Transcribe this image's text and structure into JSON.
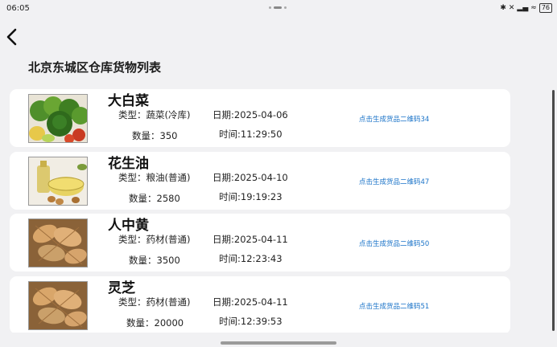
{
  "status_bar": {
    "time": "06:05",
    "battery": "76",
    "icons": [
      "bluetooth-icon",
      "mute-icon",
      "signal-icon",
      "wifi-icon"
    ]
  },
  "header": {
    "back_icon": "chevron-left-icon",
    "title": "北京东城区仓库货物列表"
  },
  "items": [
    {
      "name": "大白菜",
      "type": "类型：蔬菜(冷库)",
      "date": "日期:2025-04-06",
      "quantity": "数量：350",
      "time": "时间:11:29:50",
      "link": "点击生成货品二维码34",
      "image": "vegetables-photo"
    },
    {
      "name": "花生油",
      "type": "类型：粮油(普通)",
      "date": "日期:2025-04-10",
      "quantity": "数量：2580",
      "time": "时间:19:19:23",
      "link": "点击生成货品二维码47",
      "image": "oil-photo"
    },
    {
      "name": "人中黄",
      "type": "类型：药材(普通)",
      "date": "日期:2025-04-11",
      "quantity": "数量：3500",
      "time": "时间:12:23:43",
      "link": "点击生成货品二维码50",
      "image": "herb-slices-photo"
    },
    {
      "name": "灵芝",
      "type": "类型：药材(普通)",
      "date": "日期:2025-04-11",
      "quantity": "数量：20000",
      "time": "时间:12:39:53",
      "link": "点击生成货品二维码51",
      "image": "herb-slices-photo"
    }
  ],
  "colors": {
    "background": "#f1f1f3",
    "card": "#ffffff",
    "link": "#1a73c8"
  }
}
